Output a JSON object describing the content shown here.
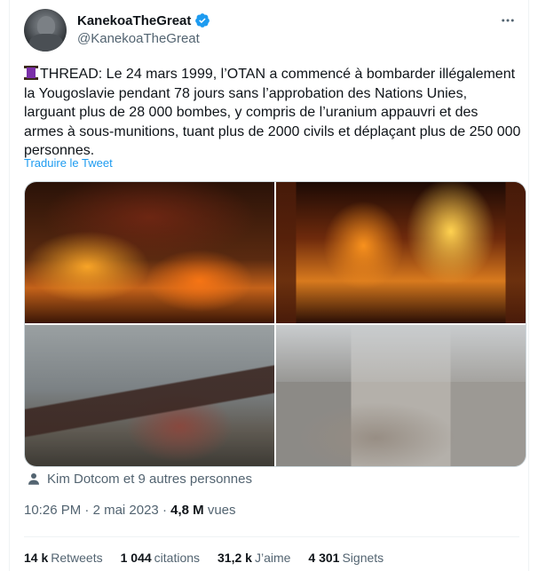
{
  "author": {
    "display_name": "KanekoaTheGreat",
    "handle": "@KanekoaTheGreat",
    "verified": true,
    "verified_color": "#1d9bf0"
  },
  "more_icon": "more-horizontal-icon",
  "tweet": {
    "text": "THREAD: Le 24 mars 1999, l’OTAN a commencé à bombarder illégalement la Yougoslavie pendant 78 jours sans l’approbation des Nations Unies, larguant plus de 28 000 bombes, y compris de l’uranium appauvri et des armes à sous-munitions, tuant plus de 2000 civils et déplaçant plus de 250 000 personnes.",
    "translate_label": "Traduire le Tweet"
  },
  "liked_by": "Kim Dotcom et 9 autres personnes",
  "meta": {
    "time": "10:26 PM",
    "separator": "·",
    "date": "2 mai 2023",
    "separator2": "·",
    "views_count": "4,8 M",
    "views_label": "vues"
  },
  "stats": {
    "retweets_count": "14 k",
    "retweets_label": "Retweets",
    "citations_count": "1 044",
    "citations_label": "citations",
    "likes_count": "31,2 k",
    "likes_label": "J’aime",
    "bookmarks_count": "4 301",
    "bookmarks_label": "Signets"
  }
}
